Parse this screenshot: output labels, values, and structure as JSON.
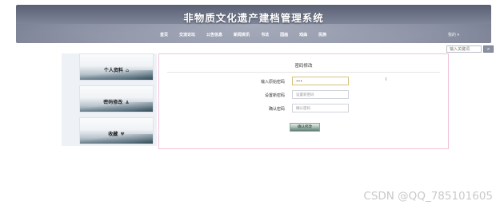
{
  "header": {
    "title": "非物质文化遗产建档管理系统",
    "nav": [
      "首页",
      "交流论坛",
      "公告信息",
      "新闻资讯",
      "书法",
      "国画",
      "戏曲",
      "民族"
    ],
    "user_menu": "我的 ▾"
  },
  "search": {
    "placeholder": "输入关键词",
    "button_icon": "search-icon"
  },
  "sidebar": {
    "items": [
      {
        "label": "个人资料",
        "icon": "home-icon",
        "glyph": "⌂"
      },
      {
        "label": "密码修改",
        "icon": "user-icon",
        "glyph": "♟"
      },
      {
        "label": "收藏",
        "icon": "heart-icon",
        "glyph": "♥"
      }
    ]
  },
  "form": {
    "title": "密码修改",
    "fields": [
      {
        "label": "输入原始密码",
        "value": "•••",
        "placeholder": ""
      },
      {
        "label": "设置新密码",
        "value": "",
        "placeholder": "设置新密码"
      },
      {
        "label": "确认密码",
        "value": "",
        "placeholder": "确认密码"
      }
    ],
    "submit_label": "确认修改"
  },
  "watermark": "CSDN @QQ_785101605",
  "colors": {
    "header_bg": "#6f7488",
    "panel_border": "#f2c4d9",
    "sidebar_bg": "#eef1f6"
  }
}
